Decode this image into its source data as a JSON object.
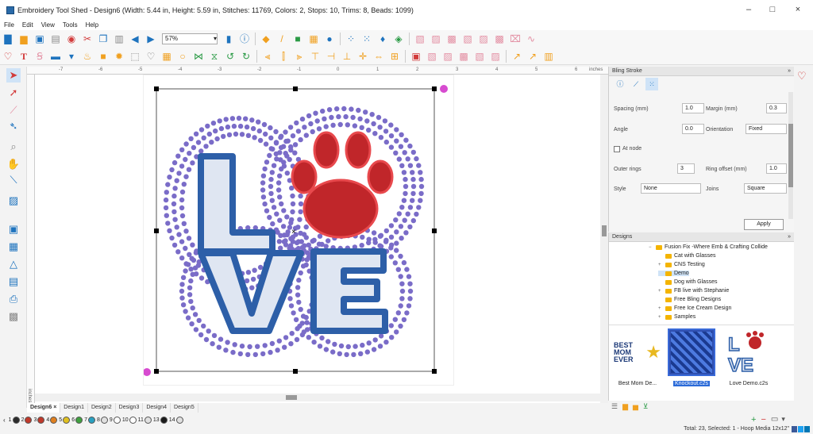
{
  "window": {
    "title": "Embroidery Tool Shed - Design6 (Width: 5.44 in, Height: 5.59 in, Stitches: 11769, Colors: 2, Stops: 10, Trims: 8, Beads: 1099)",
    "minimize": "–",
    "maximize": "□",
    "close": "×"
  },
  "menu": [
    "File",
    "Edit",
    "View",
    "Tools",
    "Help"
  ],
  "toolbar": {
    "zoom_value": "57%"
  },
  "ruler": {
    "top_ticks": [
      "-7",
      "-6",
      "-5",
      "-4",
      "-3",
      "-2",
      "-1",
      "0",
      "1",
      "2",
      "3",
      "4",
      "5",
      "6"
    ],
    "unit": "inches",
    "left_unit": "inches"
  },
  "bling_panel": {
    "title": "Bling Stroke",
    "spacing_label": "Spacing (mm)",
    "spacing_value": "1.0",
    "margin_label": "Margin (mm)",
    "margin_value": "0.3",
    "angle_label": "Angle",
    "angle_value": "0.0",
    "orientation_label": "Orientation",
    "orientation_value": "Fixed",
    "at_node_label": "At node",
    "outer_rings_label": "Outer rings",
    "outer_rings_value": "3",
    "ring_offset_label": "Ring offset (mm)",
    "ring_offset_value": "1.0",
    "style_label": "Style",
    "style_value": "None",
    "joins_label": "Joins",
    "joins_value": "Square",
    "apply_label": "Apply"
  },
  "designs_panel": {
    "title": "Designs",
    "tree": [
      {
        "label": "Fusion Fix -Where Emb & Crafting Collide",
        "level": 0,
        "expander": "−"
      },
      {
        "label": "Cat with Glasses",
        "level": 1,
        "expander": ""
      },
      {
        "label": "CNS Testing",
        "level": 1,
        "expander": "+"
      },
      {
        "label": "Demo",
        "level": 1,
        "expander": "",
        "selected": true
      },
      {
        "label": "Dog with Glasses",
        "level": 1,
        "expander": ""
      },
      {
        "label": "FB live with Stephanie",
        "level": 1,
        "expander": "+"
      },
      {
        "label": "Free Bling Designs",
        "level": 1,
        "expander": ""
      },
      {
        "label": "Free Ice Cream Design",
        "level": 1,
        "expander": "+"
      },
      {
        "label": "Samples",
        "level": 1,
        "expander": "+"
      }
    ],
    "thumbnails": [
      {
        "label": "Best Mom De...",
        "art": "BEST MOM EVER"
      },
      {
        "label": "Knockout.c2s",
        "selected": true
      },
      {
        "label": "Love Demo.c2s"
      }
    ]
  },
  "tabs": [
    {
      "label": "Design6",
      "active": true,
      "close": "×"
    },
    {
      "label": "Design1"
    },
    {
      "label": "Design2"
    },
    {
      "label": "Design3"
    },
    {
      "label": "Design4"
    },
    {
      "label": "Design5"
    }
  ],
  "colors": [
    {
      "num": "1",
      "color": "#2a2a2a"
    },
    {
      "num": "2",
      "color": "#c0392b"
    },
    {
      "num": "3",
      "color": "#c0392b"
    },
    {
      "num": "4",
      "color": "#e08020"
    },
    {
      "num": "5",
      "color": "#e0c020"
    },
    {
      "num": "6",
      "color": "#40a040"
    },
    {
      "num": "7",
      "color": "#2aa0c0"
    },
    {
      "num": "8",
      "color": "#e0e0e0"
    },
    {
      "num": "9",
      "color": "#ffffff"
    },
    {
      "num": "10",
      "color": "#ffffff"
    },
    {
      "num": "11",
      "color": "#e0e0e0"
    },
    {
      "num": "13",
      "color": "#1a1a1a"
    },
    {
      "num": "14",
      "color": "#e0e0e0"
    }
  ],
  "status": {
    "text": "Total: 23, Selected: 1 - Hoop Media 12x12\""
  },
  "design": {
    "letters": [
      "L",
      "O",
      "V",
      "E"
    ],
    "letter_fill": "#dfe6f2",
    "letter_outline": "#2d5fa8",
    "paw_fill": "#c0262a",
    "bead_color": "#7a6cc8"
  }
}
